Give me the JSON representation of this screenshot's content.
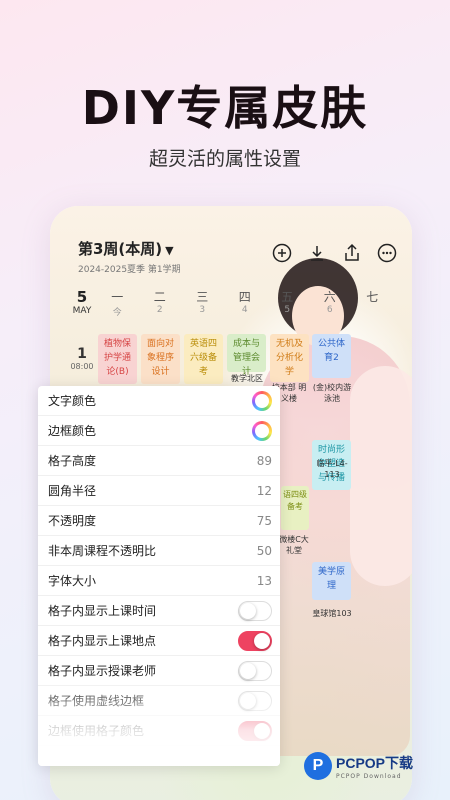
{
  "hero": {
    "title": "DIY专属皮肤",
    "subtitle": "超灵活的属性设置"
  },
  "header": {
    "week": "第3周(本周)",
    "caret": "▼",
    "term": "2024-2025夏季 第1学期",
    "icons": [
      "add-icon",
      "download-icon",
      "share-icon",
      "more-icon"
    ]
  },
  "days": {
    "date": "5",
    "month": "MAY",
    "cols": [
      {
        "n": "一",
        "s": "今"
      },
      {
        "n": "二",
        "s": "2"
      },
      {
        "n": "三",
        "s": "3"
      },
      {
        "n": "四",
        "s": "4"
      },
      {
        "n": "五",
        "s": "5"
      },
      {
        "n": "六",
        "s": "6"
      },
      {
        "n": "七",
        "s": ""
      }
    ]
  },
  "period": {
    "p": "1",
    "t": "08:00"
  },
  "courses": [
    {
      "name": "植物保护学通论(B)"
    },
    {
      "name": "面向对象程序设计"
    },
    {
      "name": "英语四六级备考"
    },
    {
      "name": "成本与管理会计"
    },
    {
      "name": "无机及分析化学"
    },
    {
      "name": "公共体育2"
    },
    {
      "name": "时尚形象塑造与传播"
    },
    {
      "name": "语四级备考"
    },
    {
      "name": "美学原理"
    }
  ],
  "locations": [
    "教学北区",
    "校本部 明义楼",
    "(金)校内游泳池",
    "临平-L4-113",
    "微楼C大礼堂",
    "皇球馆103"
  ],
  "settings": [
    {
      "label": "文字颜色",
      "type": "color"
    },
    {
      "label": "边框颜色",
      "type": "color"
    },
    {
      "label": "格子高度",
      "value": "89"
    },
    {
      "label": "圆角半径",
      "value": "12"
    },
    {
      "label": "不透明度",
      "value": "75"
    },
    {
      "label": "非本周课程不透明比",
      "value": "50"
    },
    {
      "label": "字体大小",
      "value": "13"
    },
    {
      "label": "格子内显示上课时间",
      "toggle": false
    },
    {
      "label": "格子内显示上课地点",
      "toggle": true
    },
    {
      "label": "格子内显示授课老师",
      "toggle": false
    },
    {
      "label": "格子使用虚线边框",
      "toggle": false
    },
    {
      "label": "边框使用格子颜色",
      "toggle": true
    }
  ],
  "watermark": {
    "logo": "P",
    "main": "PCPOP下载",
    "sub": "PCPOP Download"
  },
  "colors": {
    "accent": "#ee4361",
    "title": "#1a0f14"
  }
}
